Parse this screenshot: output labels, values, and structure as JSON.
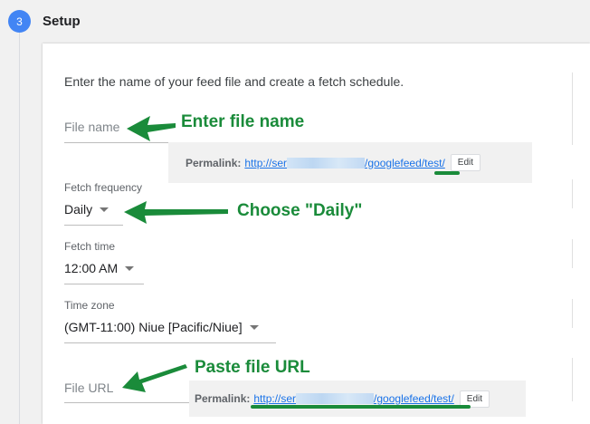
{
  "step": {
    "number": "3",
    "title": "Setup"
  },
  "card": {
    "intro": "Enter the name of your feed file and create a fetch schedule."
  },
  "file_name": {
    "placeholder": "File name"
  },
  "permalink_1": {
    "label": "Permalink:",
    "link_start": "http://ser",
    "link_end": "/googlefeed/test/",
    "edit_label": "Edit"
  },
  "fetch_frequency": {
    "label": "Fetch frequency",
    "value": "Daily"
  },
  "fetch_time": {
    "label": "Fetch time",
    "value": "12:00 AM"
  },
  "time_zone": {
    "label": "Time zone",
    "value": "(GMT-11:00) Niue [Pacific/Niue]"
  },
  "file_url": {
    "placeholder": "File URL"
  },
  "permalink_2": {
    "label": "Permalink:",
    "link_start": "http://ser",
    "link_end": "/googlefeed/test/",
    "edit_label": "Edit"
  },
  "annotations": {
    "enter_file_name": "Enter file name",
    "choose_daily": "Choose \"Daily\"",
    "paste_file_url": "Paste file URL",
    "color": "#1a8b3a"
  },
  "colors": {
    "accent": "#4285f4",
    "link": "#1a73e8"
  }
}
